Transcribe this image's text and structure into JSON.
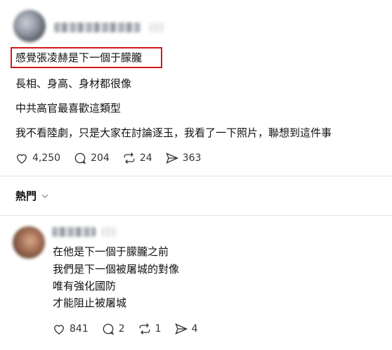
{
  "post": {
    "lines": [
      "感覺張凌赫是下一個于朦朧",
      "長相、身高、身材都很像",
      "中共高官最喜歡這類型",
      "我不看陸劇，只是大家在討論逐玉，我看了一下照片，聯想到這件事"
    ],
    "stats": {
      "likes": "4,250",
      "replies": "204",
      "reposts": "24",
      "shares": "363"
    }
  },
  "sort": {
    "label": "熱門"
  },
  "reply": {
    "lines": [
      "在他是下一個于朦朧之前",
      "我們是下一個被屠城的對像",
      "唯有強化國防",
      "才能阻止被屠城"
    ],
    "stats": {
      "likes": "841",
      "replies": "2",
      "reposts": "1",
      "shares": "4"
    }
  },
  "colors": {
    "highlight": "#d11a1a",
    "divider": "#e3e3e3"
  }
}
